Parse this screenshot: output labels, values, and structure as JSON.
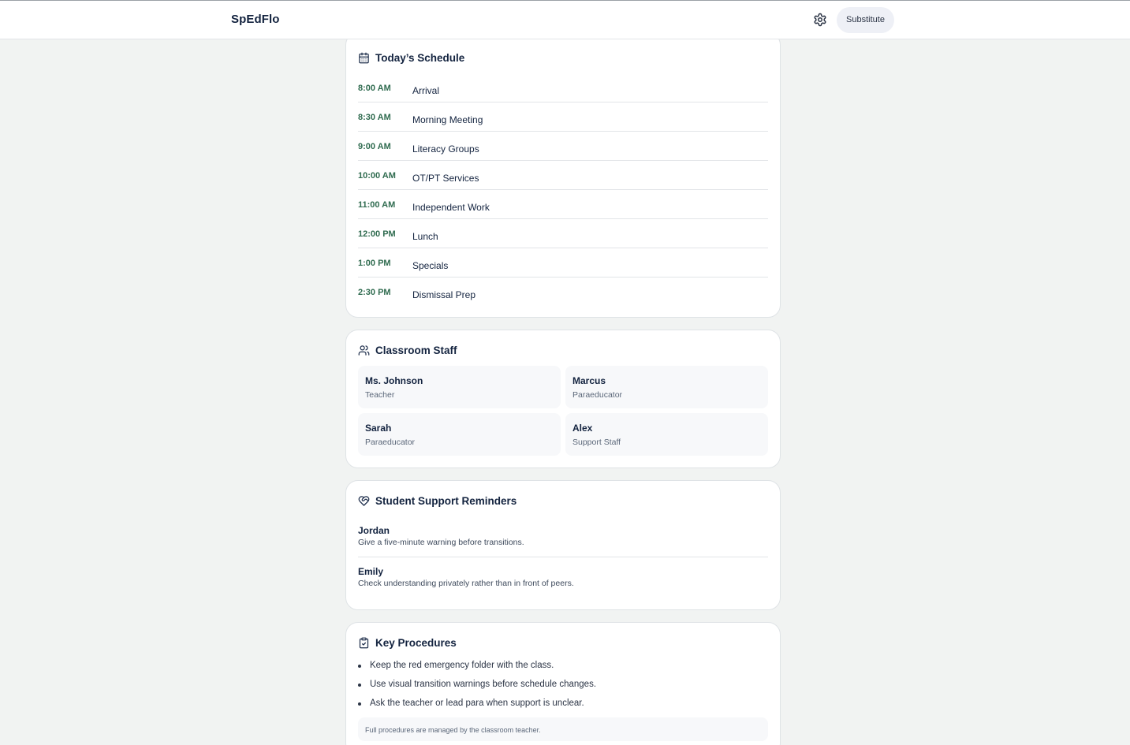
{
  "app": {
    "brand": "SpEdFlo",
    "settings_icon": "gear-icon",
    "role": "Substitute"
  },
  "schedule": {
    "title": "Today’s Schedule",
    "icon": "calendar-icon",
    "items": [
      {
        "time": "8:00 AM",
        "activity": "Arrival"
      },
      {
        "time": "8:30 AM",
        "activity": "Morning Meeting"
      },
      {
        "time": "9:00 AM",
        "activity": "Literacy Groups"
      },
      {
        "time": "10:00 AM",
        "activity": "OT/PT Services"
      },
      {
        "time": "11:00 AM",
        "activity": "Independent Work"
      },
      {
        "time": "12:00 PM",
        "activity": "Lunch"
      },
      {
        "time": "1:00 PM",
        "activity": "Specials"
      },
      {
        "time": "2:30 PM",
        "activity": "Dismissal Prep"
      }
    ]
  },
  "staff": {
    "title": "Classroom Staff",
    "icon": "users-icon",
    "members": [
      {
        "name": "Ms. Johnson",
        "role": "Teacher"
      },
      {
        "name": "Marcus",
        "role": "Paraeducator"
      },
      {
        "name": "Sarah",
        "role": "Paraeducator"
      },
      {
        "name": "Alex",
        "role": "Support Staff"
      }
    ]
  },
  "reminders": {
    "title": "Student Support Reminders",
    "icon": "heart-handshake-icon",
    "items": [
      {
        "student": "Jordan",
        "note": "Give a five-minute warning before transitions."
      },
      {
        "student": "Emily",
        "note": "Check understanding privately rather than in front of peers."
      }
    ]
  },
  "procedures": {
    "title": "Key Procedures",
    "icon": "clipboard-check-icon",
    "items": [
      "Keep the red emergency folder with the class.",
      "Use visual transition warnings before schedule changes.",
      "Ask the teacher or lead para when support is unclear."
    ],
    "footnote": "Full procedures are managed by the classroom teacher."
  },
  "colors": {
    "accent_time": "#2f6b4f",
    "text": "#13233f",
    "page_bg": "#f1f3f2"
  }
}
